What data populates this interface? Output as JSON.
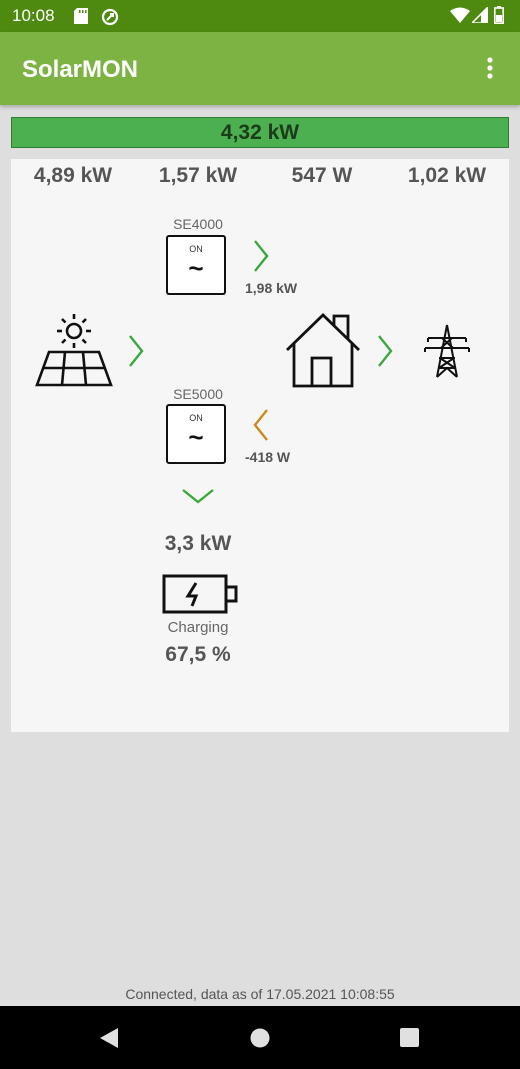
{
  "status_bar": {
    "time": "10:08"
  },
  "app": {
    "title": "SolarMON"
  },
  "total_power": "4,32 kW",
  "stats": [
    "4,89 kW",
    "1,57 kW",
    "547 W",
    "1,02 kW"
  ],
  "inverters": [
    {
      "name": "SE4000",
      "state": "ON",
      "symbol": "~",
      "flow": "1,98 kW"
    },
    {
      "name": "SE5000",
      "state": "ON",
      "symbol": "~",
      "flow": "-418 W"
    }
  ],
  "battery": {
    "power": "3,3 kW",
    "status": "Charging",
    "level": "67,5 %"
  },
  "footer": {
    "status": "Connected, data as of 17.05.2021 10:08:55"
  },
  "colors": {
    "green_arrow": "#3aa83a",
    "orange_arrow": "#c98a1a",
    "appbar": "#7cb342",
    "statusbar": "#4f8a10",
    "total_bar": "#4caf50"
  },
  "icons": [
    "sd-card-icon",
    "sync-icon",
    "wifi-icon",
    "signal-icon",
    "battery-icon",
    "more-vert-icon",
    "solar-panel-icon",
    "inverter-icon",
    "house-icon",
    "power-tower-icon",
    "battery-charging-icon",
    "back-icon",
    "home-icon",
    "recents-icon"
  ]
}
